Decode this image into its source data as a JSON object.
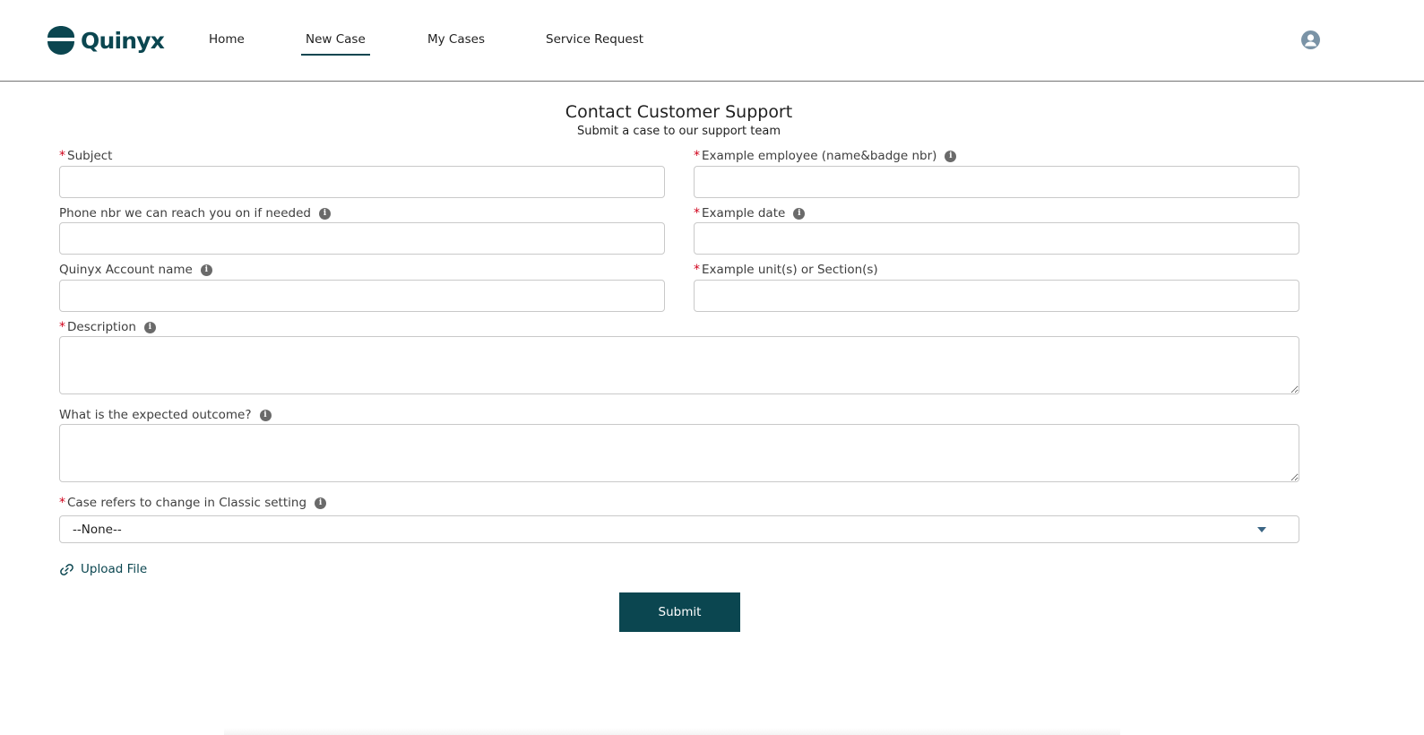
{
  "brand": {
    "name": "Quinyx",
    "color": "#0b4650"
  },
  "nav": {
    "items": [
      {
        "label": "Home"
      },
      {
        "label": "New Case",
        "active": true
      },
      {
        "label": "My Cases"
      },
      {
        "label": "Service Request"
      }
    ]
  },
  "user": {
    "icon": "user-avatar-icon"
  },
  "page": {
    "title": "Contact Customer Support",
    "subtitle": "Submit a case to our support team"
  },
  "form": {
    "required_marker": "*",
    "subject": {
      "label": "Subject",
      "required": true,
      "value": ""
    },
    "example_employee": {
      "label": "Example employee (name&badge nbr)",
      "required": true,
      "value": "",
      "icon": "info-icon"
    },
    "phone": {
      "label": "Phone nbr we can reach you on if needed",
      "required": false,
      "value": "",
      "icon": "info-icon"
    },
    "example_date": {
      "label": "Example date",
      "required": true,
      "value": "",
      "icon": "info-icon"
    },
    "account_name": {
      "label": "Quinyx Account name",
      "required": false,
      "value": "",
      "icon": "info-icon"
    },
    "example_units": {
      "label": "Example unit(s) or Section(s)",
      "required": true,
      "value": ""
    },
    "description": {
      "label": "Description",
      "required": true,
      "value": "",
      "icon": "info-icon"
    },
    "expected_outcome": {
      "label": "What is the expected outcome?",
      "required": false,
      "value": "",
      "icon": "info-icon"
    },
    "classic_setting": {
      "label": "Case refers to change in Classic setting",
      "required": true,
      "selected": "--None--",
      "icon": "info-icon"
    },
    "upload": {
      "label": "Upload File",
      "icon": "paperclip-icon"
    },
    "submit_label": "Submit"
  },
  "colors": {
    "required": "#d0021b",
    "accent": "#0b4650",
    "border": "#c9c9c9"
  }
}
